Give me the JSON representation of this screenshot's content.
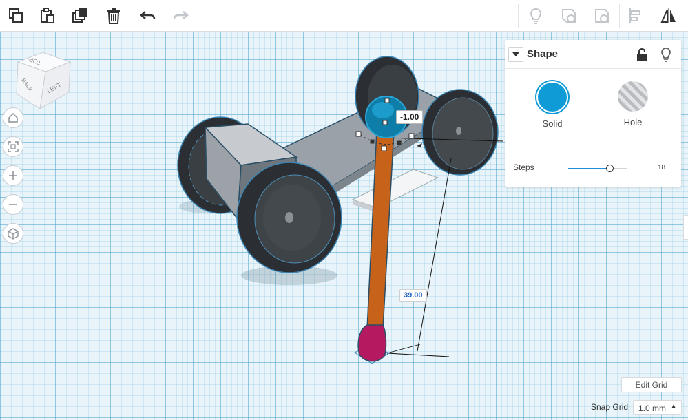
{
  "toolbar": {
    "icons": [
      "copy-icon",
      "paste-icon",
      "duplicate-icon",
      "delete-icon",
      "undo-icon",
      "redo-icon",
      "note-icon",
      "comment-icon",
      "show-hidden-icon",
      "align-icon",
      "mirror-icon"
    ]
  },
  "viewcube": {
    "top": "TOP",
    "back": "BACK",
    "left": "LEFT"
  },
  "view_controls": [
    "home-view-icon",
    "fit-view-icon",
    "zoom-in-icon",
    "zoom-out-icon",
    "ortho-view-icon"
  ],
  "dimensions": {
    "top_offset": "-1.00",
    "height": "39.00"
  },
  "shape_panel": {
    "title": "Shape",
    "solid_label": "Solid",
    "hole_label": "Hole",
    "steps_label": "Steps",
    "steps_value": "18",
    "steps_fraction": 0.71,
    "solid_color": "#0e9bd6"
  },
  "edit_grid_label": "Edit Grid",
  "snap_grid": {
    "label": "Snap Grid",
    "value": "1.0 mm"
  }
}
